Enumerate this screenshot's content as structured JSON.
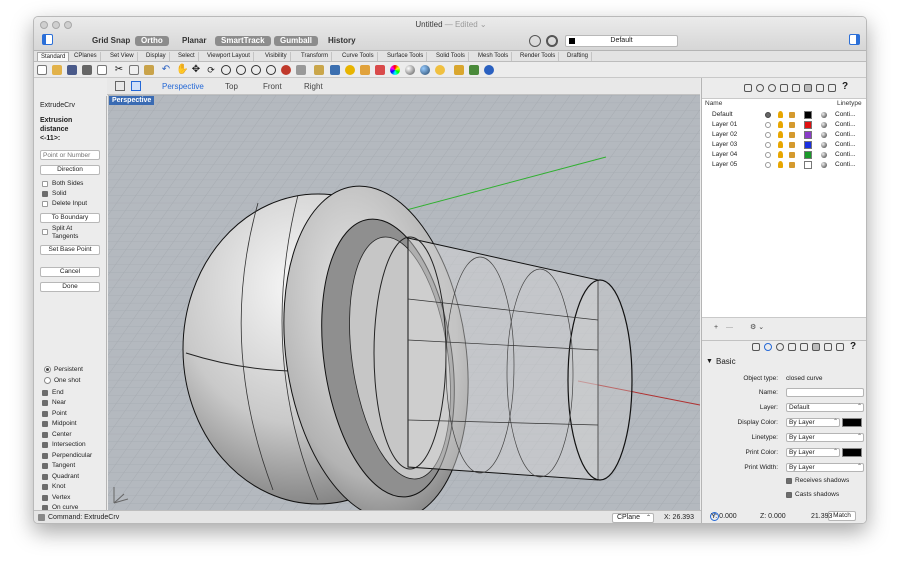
{
  "window": {
    "title": "Untitled",
    "edited": "— Edited ⌄"
  },
  "toolbar": {
    "grid_snap": "Grid Snap",
    "ortho": "Ortho",
    "planar": "Planar",
    "smarttrack": "SmartTrack",
    "gumball": "Gumball",
    "history": "History",
    "current_layer": "Default"
  },
  "tabs": [
    "Standard",
    "CPlanes",
    "Set View",
    "Display",
    "Select",
    "Viewport Layout",
    "Visibility",
    "Transform",
    "Curve Tools",
    "Surface Tools",
    "Solid Tools",
    "Mesh Tools",
    "Render Tools",
    "Drafting"
  ],
  "command_panel": {
    "command": "ExtrudeCrv",
    "prompt_line1": "Extrusion",
    "prompt_line2": "distance",
    "prompt_line3": "<-11>:",
    "input_placeholder": "Point or Number",
    "direction": "Direction",
    "both_sides": "Both Sides",
    "solid": "Solid",
    "delete_input": "Delete Input",
    "to_boundary": "To Boundary",
    "split_at_tangents_1": "Split At",
    "split_at_tangents_2": "Tangents",
    "set_base_point": "Set Base Point",
    "cancel": "Cancel",
    "done": "Done"
  },
  "osnap": {
    "persistent": "Persistent",
    "one_shot": "One shot",
    "items": [
      "End",
      "Near",
      "Point",
      "Midpoint",
      "Center",
      "Intersection",
      "Perpendicular",
      "Tangent",
      "Quadrant",
      "Knot",
      "Vertex",
      "On curve"
    ]
  },
  "viewport_tabs": [
    "Perspective",
    "Top",
    "Front",
    "Right"
  ],
  "viewport_label": "Perspective",
  "layers": {
    "col_name": "Name",
    "col_linetype": "Linetype",
    "rows": [
      {
        "name": "Default",
        "color": "#000000",
        "linetype": "Conti..."
      },
      {
        "name": "Layer 01",
        "color": "#e01010",
        "linetype": "Conti..."
      },
      {
        "name": "Layer 02",
        "color": "#8a3cc8",
        "linetype": "Conti..."
      },
      {
        "name": "Layer 03",
        "color": "#1a2fe0",
        "linetype": "Conti..."
      },
      {
        "name": "Layer 04",
        "color": "#1a9a2a",
        "linetype": "Conti..."
      },
      {
        "name": "Layer 05",
        "color": "#ffffff",
        "linetype": "Conti..."
      }
    ]
  },
  "properties": {
    "section": "Basic",
    "object_type_label": "Object type:",
    "object_type_value": "closed curve",
    "name_label": "Name:",
    "layer_label": "Layer:",
    "layer_value": "Default",
    "display_color_label": "Display Color:",
    "display_color_value": "By Layer",
    "linetype_label": "Linetype:",
    "linetype_value": "By Layer",
    "print_color_label": "Print Color:",
    "print_color_value": "By Layer",
    "print_width_label": "Print Width:",
    "print_width_value": "By Layer",
    "receives_shadows": "Receives shadows",
    "casts_shadows": "Casts shadows",
    "match": "Match",
    "help": "?"
  },
  "status": {
    "command": "Command: ExtrudeCrv",
    "cplane": "CPlane",
    "x": "X: 26.393",
    "y": "Y: 0.000",
    "z": "Z: 0.000",
    "dist": "21.393"
  }
}
